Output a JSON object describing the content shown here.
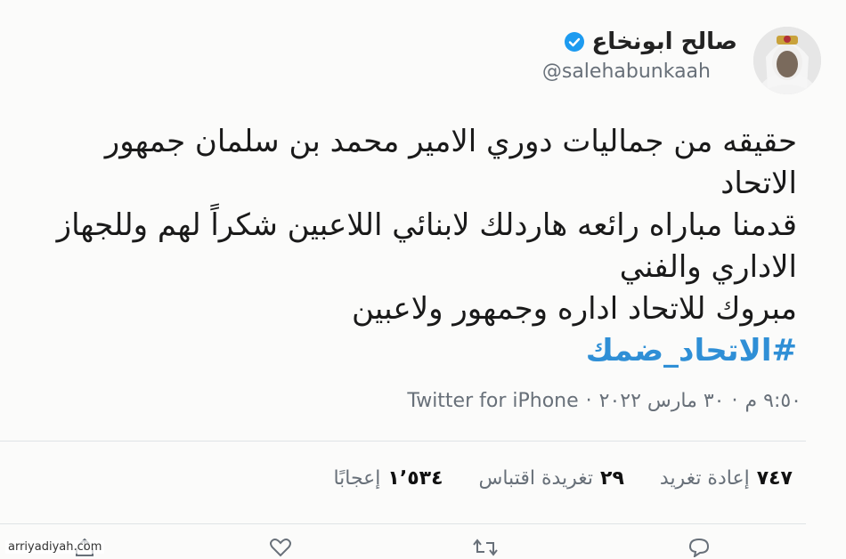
{
  "header": {
    "display_name": "صالح ابونخاع",
    "handle": "@salehabunkaah"
  },
  "tweet": {
    "lines": [
      "حقيقه من جماليات دوري الامير محمد بن سلمان جمهور",
      "الاتحاد",
      "قدمنا مباراه رائعه هاردلك لابنائي اللاعبين شكراً لهم وللجهاز",
      "الاداري والفني",
      "مبروك للاتحاد اداره وجمهور ولاعبين"
    ],
    "hashtag": "#الاتحاد_ضمك"
  },
  "meta": {
    "time": "٩:٥٠ م",
    "date": "٣٠ مارس ٢٠٢٢",
    "source": "Twitter for iPhone"
  },
  "stats": {
    "retweets_value": "٧٤٧",
    "retweets_label": "إعادة تغريد",
    "quotes_value": "٢٩",
    "quotes_label": "تغريدة اقتباس",
    "likes_value": "١٬٥٣٤",
    "likes_label": "إعجابًا"
  },
  "watermark": "arriyadiyah.com",
  "colors": {
    "hashtag": "#2f8fd6",
    "verified": "#1d9bf0",
    "secondary_text": "#687079"
  },
  "icons": [
    "verified-badge-icon",
    "reply-icon",
    "retweet-icon",
    "like-icon",
    "share-icon"
  ]
}
